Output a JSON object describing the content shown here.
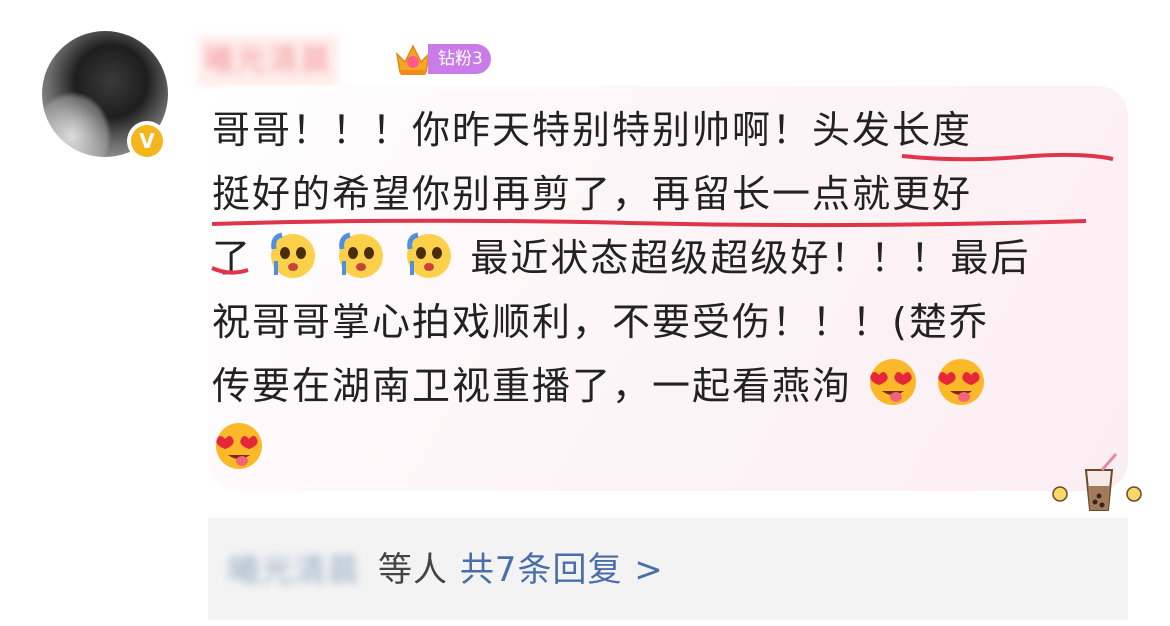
{
  "user": {
    "name": "曦光清晨",
    "badge_label": "钻粉3",
    "verified_icon": "V"
  },
  "comment": {
    "line1": "哥哥！！！你昨天特别特别帅啊！头发长度",
    "line2": "挺好的希望你别再剪了，再留长一点就更好",
    "line3_start": "了",
    "line3_end": "最近状态超级超级好！！！最后",
    "line4": "祝哥哥掌心拍戏顺利，不要受伤！！！(楚乔",
    "line5": "传要在湖南卫视重播了，一起看燕洵"
  },
  "replies": {
    "names": "曦光清晨",
    "suffix": "等人",
    "count_link": "共7条回复 >"
  },
  "colors": {
    "underline": "#e0344a",
    "badge": "#c97ce8",
    "verified": "#f5b51c",
    "link": "#4a6fa8"
  }
}
